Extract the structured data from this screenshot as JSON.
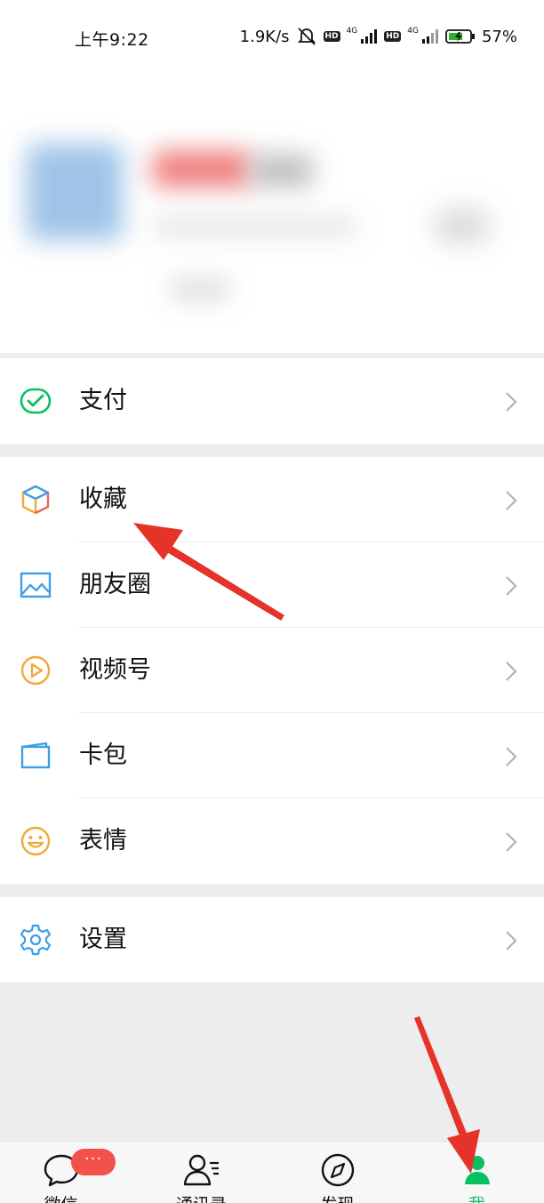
{
  "status_bar": {
    "time": "上午9:22",
    "speed": "1.9K/s",
    "hd1": "HD",
    "net1": "4G",
    "hd2": "HD",
    "net2": "4G",
    "battery": "57%"
  },
  "menu": {
    "pay": "支付",
    "favorites": "收藏",
    "moments": "朋友圈",
    "channels": "视频号",
    "cards": "卡包",
    "stickers": "表情",
    "settings": "设置"
  },
  "tabbar": {
    "chats_label": "微信",
    "chats_badge": "···",
    "contacts_label": "通讯录",
    "discover_label": "发现",
    "me_label": "我"
  },
  "colors": {
    "accent_green": "#07c160",
    "annotation_red": "#e5332a",
    "badge_red": "#f2504a"
  }
}
